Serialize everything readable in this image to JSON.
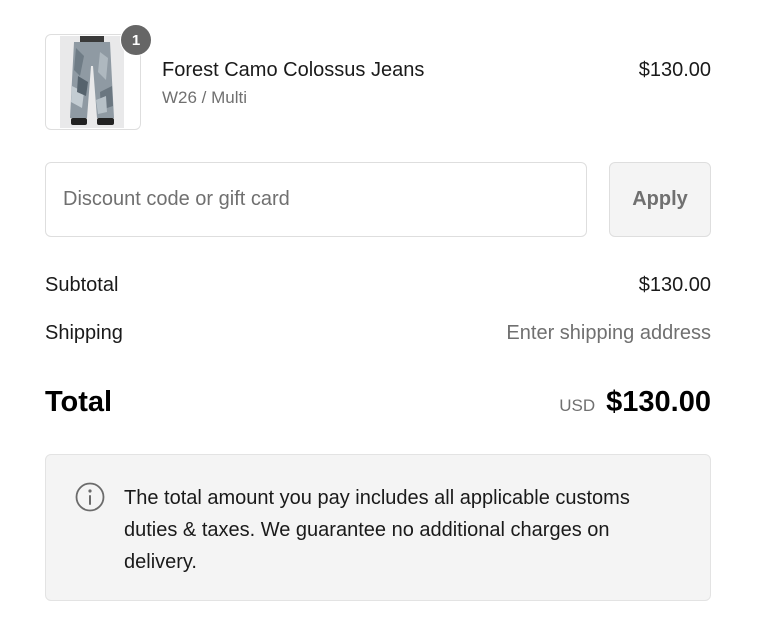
{
  "line_item": {
    "quantity": "1",
    "name": "Forest Camo Colossus Jeans",
    "variant": "W26 / Multi",
    "price": "$130.00",
    "image_icon": "jeans-product-image"
  },
  "discount": {
    "placeholder": "Discount code or gift card",
    "value": "",
    "apply_label": "Apply"
  },
  "summary": {
    "subtotal_label": "Subtotal",
    "subtotal_value": "$130.00",
    "shipping_label": "Shipping",
    "shipping_value": "Enter shipping address",
    "total_label": "Total",
    "total_currency": "USD",
    "total_value": "$130.00"
  },
  "notice": {
    "icon": "info-icon",
    "text": "The total amount you pay includes all applicable customs duties & taxes. We guarantee no additional charges on delivery."
  },
  "colors": {
    "badge": "#666666",
    "muted_text": "#707070",
    "border": "#dedede",
    "notice_background": "#f4f4f4"
  }
}
